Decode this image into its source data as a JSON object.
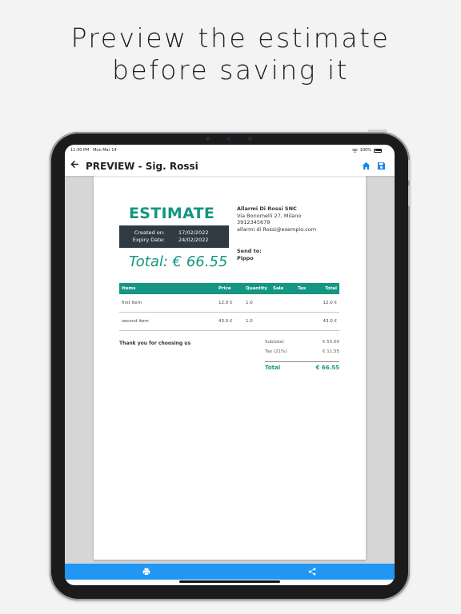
{
  "headline": {
    "line1": "Preview the estimate",
    "line2": "before saving it"
  },
  "status_bar": {
    "time": "11:30 PM",
    "date": "Mon Mar 14",
    "battery": "100%"
  },
  "app_bar": {
    "back_icon": "arrow-left-icon",
    "title": "PREVIEW - Sig. Rossi",
    "home_icon": "home-icon",
    "save_icon": "floppy-disk-icon",
    "accent_color": "#1e88e5"
  },
  "document": {
    "title": "ESTIMATE",
    "title_color": "#149683",
    "created_label": "Created on:",
    "created_value": "17/02/2022",
    "expiry_label": "Expiry Date:",
    "expiry_value": "24/02/2022",
    "total_big": "Total: € 66.55",
    "company": {
      "name": "Allarmi Di Rossi SNC",
      "address": "Via Bonomelli 27, Milano",
      "phone": "3912345678",
      "email": "allarmi di Rossi@esempio.com"
    },
    "send_to_label": "Send to:",
    "send_to_name": "Pippo",
    "table": {
      "headers": {
        "items": "Items",
        "price": "Price",
        "quantity": "Quantity",
        "sale": "Sale",
        "tax": "Tax",
        "total": "Total"
      },
      "rows": [
        {
          "item": "first item",
          "price": "12.0 €",
          "quantity": "1.0",
          "sale": "",
          "tax": "",
          "total": "12.0 €"
        },
        {
          "item": "second item",
          "price": "43.0 €",
          "quantity": "1.0",
          "sale": "",
          "tax": "",
          "total": "43.0 €"
        }
      ]
    },
    "thanks": "Thank you for choosing us",
    "summary": {
      "subtotal_label": "Subtotal:",
      "subtotal_value": "€ 55.00",
      "tax_label": "Tax (21%)",
      "tax_value": "€ 11.55",
      "total_label": "Total",
      "total_value": "€ 66.55"
    }
  },
  "bottom_bar": {
    "color": "#2196f3",
    "print_icon": "printer-icon",
    "share_icon": "share-icon"
  }
}
